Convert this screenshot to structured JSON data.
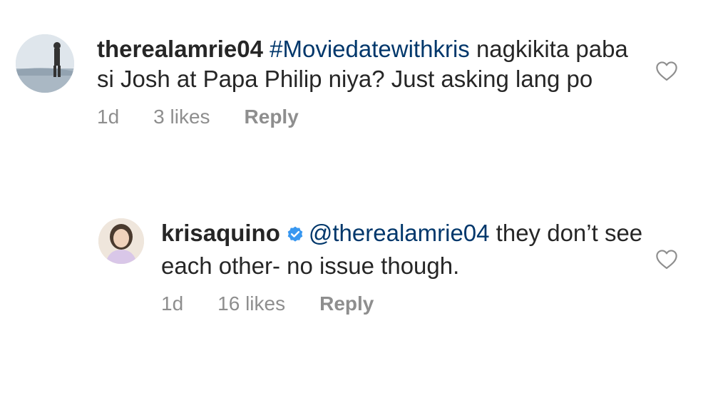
{
  "comments": [
    {
      "username": "therealamrie04",
      "hashtag": "#Moviedatewithkris",
      "text": " nagkikita paba si Josh at Papa Philip niya? Just asking lang po",
      "time": "1d",
      "likes": "3 likes",
      "reply_label": "Reply",
      "avatar_icon": "profile-photo",
      "like_icon": "heart-outline-icon"
    },
    {
      "username": "krisaquino",
      "verified": true,
      "mention": "@therealamrie04",
      "text": " they don’t see each other- no issue though.",
      "time": "1d",
      "likes": "16 likes",
      "reply_label": "Reply",
      "avatar_icon": "profile-photo",
      "like_icon": "heart-outline-icon"
    }
  ],
  "colors": {
    "link": "#00376b",
    "meta": "#8e8e8e",
    "text": "#262626",
    "verified": "#3897f0"
  }
}
